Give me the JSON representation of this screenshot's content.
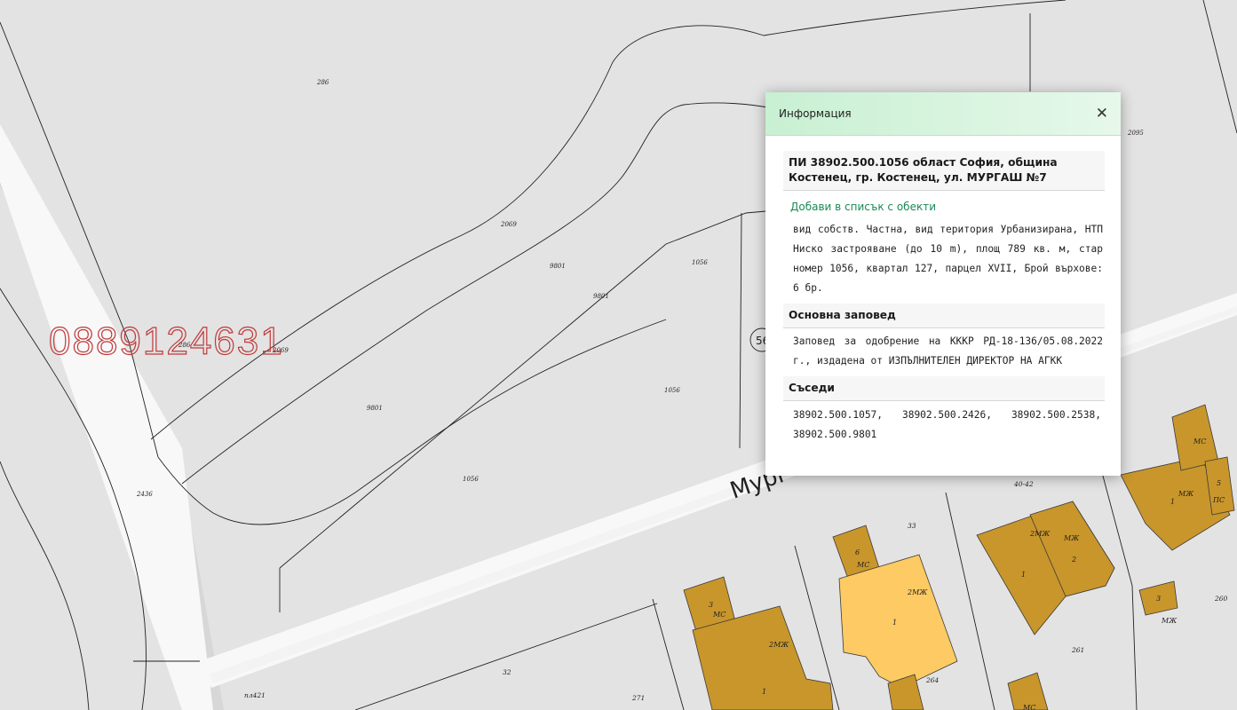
{
  "map": {
    "parcel_labels": [
      "286",
      "2069",
      "9801",
      "9801",
      "1056",
      "286",
      "2069",
      "9801",
      "1056",
      "1056",
      "2436",
      "2095"
    ],
    "street_name": "Мург",
    "lower_labels": [
      "33",
      "40-42",
      "32",
      "271",
      "261",
      "264",
      "260",
      "пл421"
    ],
    "building_labels": [
      "3",
      "МС",
      "2МЖ",
      "1",
      "6",
      "МС",
      "2МЖ",
      "1",
      "2МЖ",
      "МЖ",
      "1",
      "2",
      "3",
      "МЖ",
      "МЖ",
      "1",
      "МС",
      "5",
      "ПС",
      "МС"
    ],
    "circle_label": "56",
    "watermark_phone": "0889124631",
    "colors": {
      "background": "#e3e3e3",
      "street": "#f8f8f8",
      "building": "#c9962b",
      "building_highlight": "#fdca63",
      "watermark": "#c0393b"
    }
  },
  "popup": {
    "title": "Информация",
    "close_icon": "close-icon",
    "heading": "ПИ 38902.500.1056 област София, община Костенец, гр. Костенец, ул. МУРГАШ №7",
    "add_link": "Добави в списък с обекти",
    "details": "вид собств. Частна, вид територия Урбанизирана, НТП Ниско застрояване (до 10 m), площ 789 кв. м, стар номер 1056, квартал 127, парцел XVII, Брой върхове: 6 бр.",
    "order_heading": "Основна заповед",
    "order_text": "Заповед за одобрение на КККР РД-18-136/05.08.2022 г., издадена от ИЗПЪЛНИТЕЛЕН ДИРЕКТОР НА АГКК",
    "neighbors_heading": "Съседи",
    "neighbors": [
      "38902.500.1057,",
      "38902.500.2426,",
      "38902.500.2538,",
      "38902.500.9801"
    ]
  }
}
